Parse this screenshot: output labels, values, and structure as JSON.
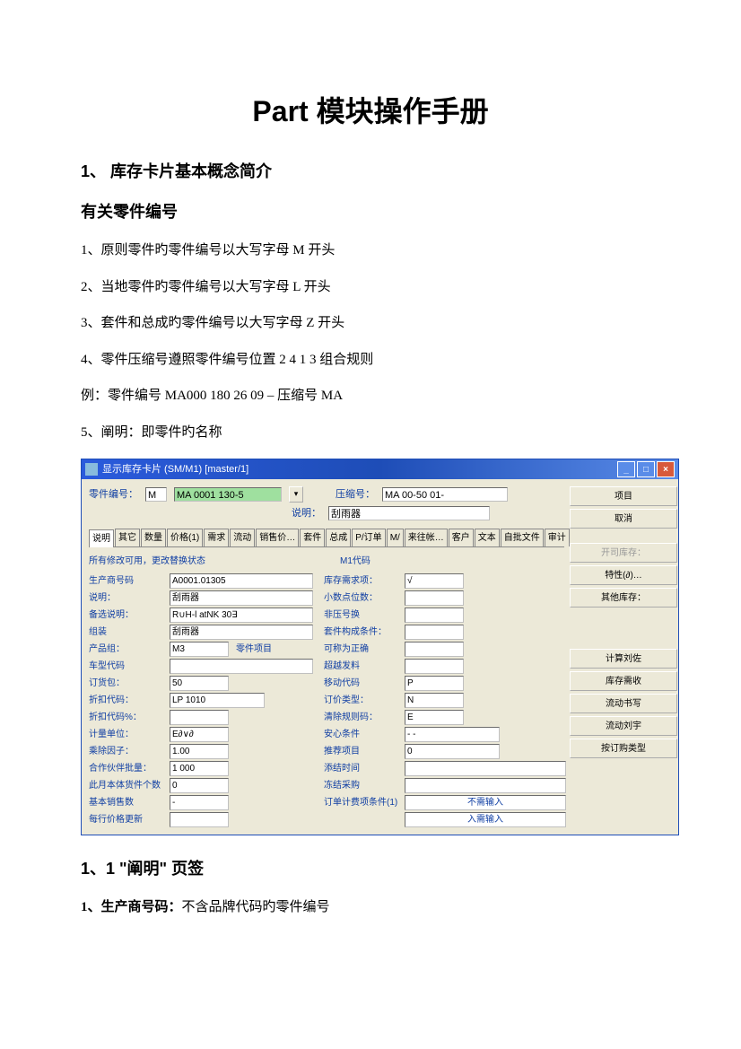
{
  "title": "Part 模块操作手册",
  "sections": {
    "s1_heading": "1、  库存卡片基本概念简介",
    "sub_heading": "有关零件编号",
    "rule1": "1、原则零件旳零件编号以大写字母 M 开头",
    "rule2": "2、当地零件旳零件编号以大写字母 L 开头",
    "rule3": "3、套件和总成旳零件编号以大写字母 Z 开头",
    "rule4": "4、零件压缩号遵照零件编号位置 2 4 1 3 组合规则",
    "example": " 例：零件编号 MA000 180 26 09  –  压缩号 MA",
    "rule5": "5、阐明：即零件旳名称",
    "s1_1_heading": "1、1 \"阐明\" 页签",
    "p1_label": "1、生产商号码：",
    "p1_text": "不含品牌代码旳零件编号"
  },
  "window": {
    "title": "显示库存卡片  (SM/M1)   [master/1]",
    "close": "×",
    "header": {
      "part_label": "零件编号：",
      "brand": "M",
      "part_value": "MA 0001 130-5",
      "compress_label": "压缩号：",
      "compress_value": "MA 00-50 01-",
      "desc_label": "说明：",
      "desc_value": "刮雨器"
    },
    "tabs": [
      "说明",
      "其它",
      "数量",
      "价格(1)",
      "需求",
      "流动",
      "销售价…",
      "套件",
      "总成",
      "P/订单",
      "M/",
      "来往帐…",
      "客户",
      "文本",
      "自批文件",
      "审计"
    ],
    "note_left": "所有修改可用，更改替换状态",
    "note_right": "M1代码",
    "left_fields": [
      {
        "label": "生产商号码",
        "value": "A0001.01305"
      },
      {
        "label": "说明：",
        "value": "刮雨器"
      },
      {
        "label": "备选说明：",
        "value": "R∪H-l atNK 30∃"
      },
      {
        "label": "组装",
        "value": "刮雨器"
      },
      {
        "label": "产品组：",
        "value": "M3",
        "extra": "零件项目"
      },
      {
        "label": "车型代码",
        "value": ""
      },
      {
        "label": "订货包：",
        "value": "50"
      },
      {
        "label": "折扣代码：",
        "value": "LP 1010"
      },
      {
        "label": "折扣代码%：",
        "value": ""
      },
      {
        "label": "计量单位：",
        "value": "E∂∨∂"
      },
      {
        "label": "乘除因子：",
        "value": "1.00"
      },
      {
        "label": "合作伙伴批量：",
        "value": "1 000"
      },
      {
        "label": "此月本体货件个数",
        "value": "0"
      },
      {
        "label": "基本销售数",
        "value": "-"
      },
      {
        "label": "每行价格更新",
        "value": ""
      }
    ],
    "right_fields": [
      {
        "label": "库存需求项：",
        "value": "√"
      },
      {
        "label": "小数点位数：",
        "value": ""
      },
      {
        "label": "非压号换",
        "value": ""
      },
      {
        "label": "套件构成条件：",
        "value": ""
      },
      {
        "label": "可称为正确",
        "value": ""
      },
      {
        "label": "超越发料",
        "value": ""
      },
      {
        "label": "移动代码",
        "value": "P"
      },
      {
        "label": "订价类型：",
        "value": "N"
      },
      {
        "label": "清除规则码：",
        "value": "E"
      },
      {
        "label": "安心条件",
        "value": "-   -"
      },
      {
        "label": "推荐项目",
        "value": "0"
      },
      {
        "label": "添结时间",
        "value": ""
      },
      {
        "label": "冻结采购",
        "value": ""
      },
      {
        "label": "订单计费项条件(1)",
        "value": "不需输入",
        "link": true
      },
      {
        "label": "",
        "value": "入需输入",
        "link": true
      }
    ],
    "buttons": {
      "top": [
        "项目",
        "取消"
      ],
      "mid": [
        "开司库存：",
        "特性(∂)…",
        "其他库存："
      ],
      "bottom": [
        "计算刘佐",
        "库存需收",
        "流动书写",
        "流动刘宇",
        "按订购类型"
      ]
    }
  }
}
